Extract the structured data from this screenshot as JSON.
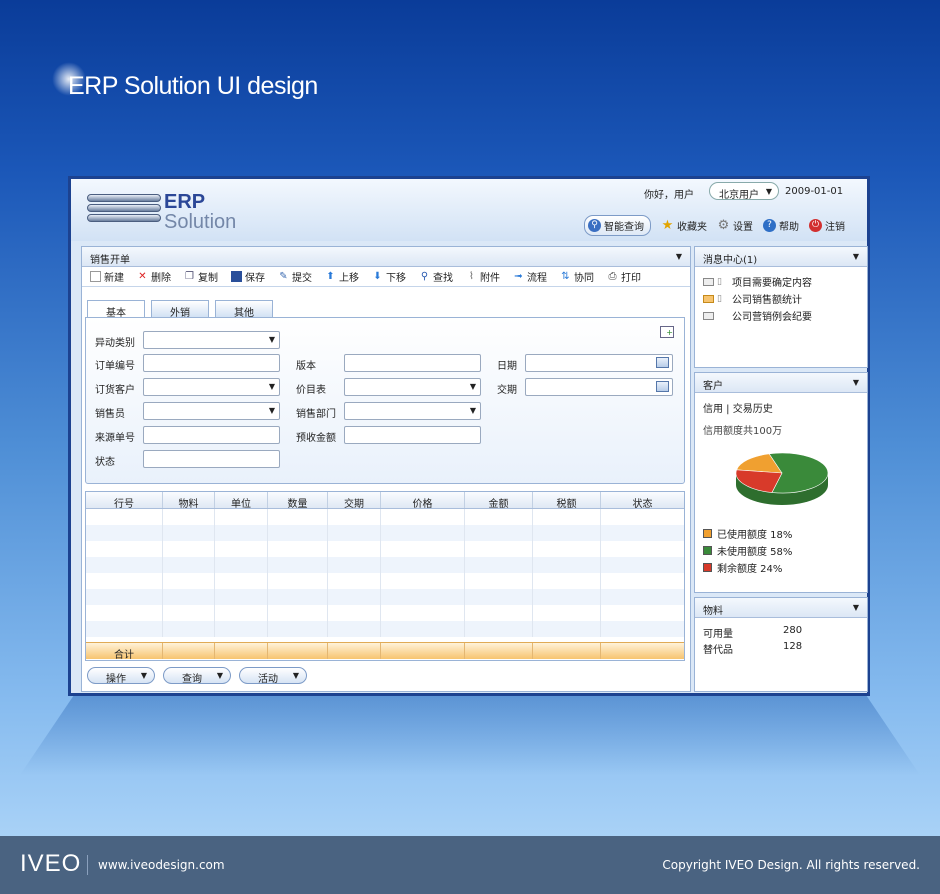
{
  "page": {
    "headline": "ERP Solution UI design",
    "footer": {
      "brand": "IVEO",
      "url": "www.iveodesign.com",
      "copyright": "Copyright IVEO Design. All rights reserved."
    }
  },
  "app": {
    "logo": {
      "line1": "ERP",
      "line2": "Solution"
    },
    "greeting": "你好，用户",
    "location": "北京用户",
    "date": "2009-01-01",
    "top_links": [
      {
        "label": "智能查询",
        "icon": "search-icon"
      },
      {
        "label": "收藏夹",
        "icon": "star-icon"
      },
      {
        "label": "设置",
        "icon": "gear-icon"
      },
      {
        "label": "帮助",
        "icon": "help-icon"
      },
      {
        "label": "注销",
        "icon": "power-icon"
      }
    ]
  },
  "main": {
    "title": "销售开单",
    "toolbar": [
      {
        "label": "新建",
        "icon": "new-icon"
      },
      {
        "label": "删除",
        "icon": "delete-icon"
      },
      {
        "label": "复制",
        "icon": "copy-icon"
      },
      {
        "label": "保存",
        "icon": "save-icon"
      },
      {
        "label": "提交",
        "icon": "submit-icon"
      },
      {
        "label": "上移",
        "icon": "up-arrow-icon"
      },
      {
        "label": "下移",
        "icon": "down-arrow-icon"
      },
      {
        "label": "查找",
        "icon": "search-icon"
      },
      {
        "label": "附件",
        "icon": "attachment-icon"
      },
      {
        "label": "流程",
        "icon": "flow-icon"
      },
      {
        "label": "协同",
        "icon": "collaborate-icon"
      },
      {
        "label": "打印",
        "icon": "print-icon"
      }
    ],
    "tabs": [
      "基本",
      "外销",
      "其他"
    ],
    "form": {
      "change_type": "异动类别",
      "order_no": "订单编号",
      "order_customer": "订货客户",
      "salesman": "销售员",
      "source_no": "来源单号",
      "status": "状态",
      "version": "版本",
      "price_list": "价目表",
      "sales_dept": "销售部门",
      "prepaid_amount": "预收金额",
      "date": "日期",
      "delivery": "交期"
    },
    "grid": {
      "columns": [
        "行号",
        "物料",
        "单位",
        "数量",
        "交期",
        "价格",
        "金额",
        "税额",
        "状态"
      ],
      "total_label": "合计"
    },
    "buttons": [
      "操作",
      "查询",
      "活动"
    ]
  },
  "messages": {
    "title": "消息中心(1)",
    "items": [
      "项目需要确定内容",
      "公司销售额统计",
      "公司营销例会纪要"
    ]
  },
  "customer": {
    "title": "客户",
    "links": "信用 | 交易历史",
    "credit": "信用额度共100万",
    "legend": [
      {
        "label": "已使用额度 18%",
        "color": "#f0a030"
      },
      {
        "label": "未使用额度 58%",
        "color": "#3a8a3a"
      },
      {
        "label": "剩余额度 24%",
        "color": "#d83a2a"
      }
    ],
    "chart_data": {
      "type": "pie",
      "categories": [
        "已使用额度",
        "未使用额度",
        "剩余额度"
      ],
      "values": [
        18,
        58,
        24
      ]
    }
  },
  "material": {
    "title": "物料",
    "rows": [
      {
        "k": "可用量",
        "v": "280"
      },
      {
        "k": "替代品",
        "v": "128"
      }
    ]
  }
}
